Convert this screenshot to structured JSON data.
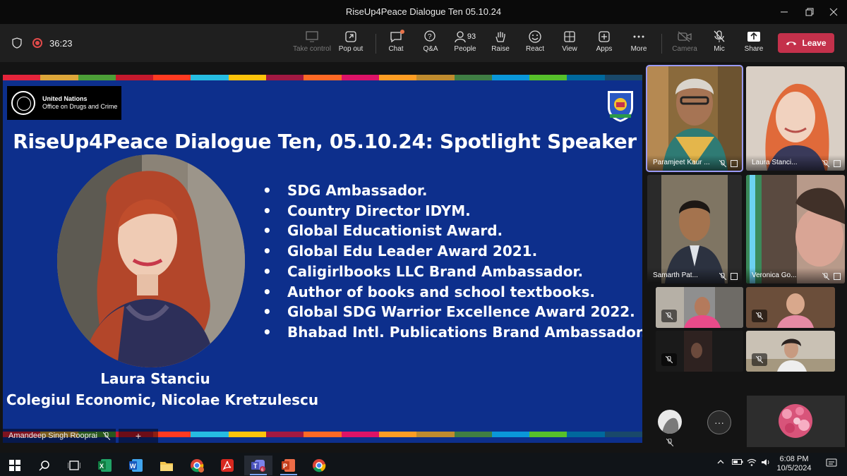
{
  "window": {
    "title": "RiseUp4Peace Dialogue Ten 05.10.24"
  },
  "toolbar": {
    "timer": "36:23",
    "take_control": "Take control",
    "pop_out": "Pop out",
    "chat": "Chat",
    "qa": "Q&A",
    "people": "People",
    "people_count": "93",
    "raise": "Raise",
    "react": "React",
    "view": "View",
    "apps": "Apps",
    "more": "More",
    "camera": "Camera",
    "mic": "Mic",
    "share": "Share",
    "leave": "Leave"
  },
  "slide": {
    "org_name": "United Nations",
    "org_office": "Office on Drugs and Crime",
    "title": "RiseUp4Peace Dialogue Ten, 05.10.24: Spotlight Speaker",
    "bullets": [
      "SDG Ambassador.",
      "Country Director IDYM.",
      "Global Educationist Award.",
      "Global Edu Leader Award 2021.",
      "Caligirlbooks LLC Brand Ambassador.",
      "Author of books and school textbooks.",
      "Global SDG Warrior Excellence Award 2022.",
      "Bhabad Intl. Publications Brand Ambassador."
    ],
    "speaker_name": "Laura Stanciu",
    "speaker_org": "Colegiul Economic, Nicolae Kretzulescu",
    "sdg_colors": [
      "#e5243b",
      "#dda63a",
      "#4c9f38",
      "#c5192d",
      "#ff3a21",
      "#26bde2",
      "#fcc30b",
      "#a21942",
      "#fd6925",
      "#dd1367",
      "#fd9d24",
      "#bf8b2e",
      "#3f7e44",
      "#0a97d9",
      "#56c02b",
      "#00689d",
      "#19486a"
    ]
  },
  "presenter": {
    "name": "Amandeep Singh Rooprai"
  },
  "participants": [
    {
      "name": "Paramjeet Kaur ..."
    },
    {
      "name": "Laura Stanci..."
    },
    {
      "name": "Samarth Pat..."
    },
    {
      "name": "Veronica Go..."
    }
  ],
  "taskbar": {
    "time": "6:08 PM",
    "date": "10/5/2024"
  }
}
